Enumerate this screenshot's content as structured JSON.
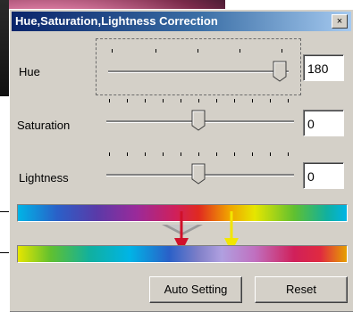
{
  "dialog": {
    "title": "Hue,Saturation,Lightness Correction",
    "close_icon": "close-icon",
    "close_glyph": "×"
  },
  "controls": {
    "hue": {
      "label": "Hue",
      "value": "180"
    },
    "saturation": {
      "label": "Saturation",
      "value": "0"
    },
    "lightness": {
      "label": "Lightness",
      "value": "0"
    }
  },
  "buttons": {
    "auto_setting": "Auto Setting",
    "reset": "Reset"
  },
  "colors": {
    "title_start": "#0a246a",
    "title_end": "#a6caf0",
    "red_arrow": "#d0102a",
    "yellow_arrow": "#f2e600"
  }
}
